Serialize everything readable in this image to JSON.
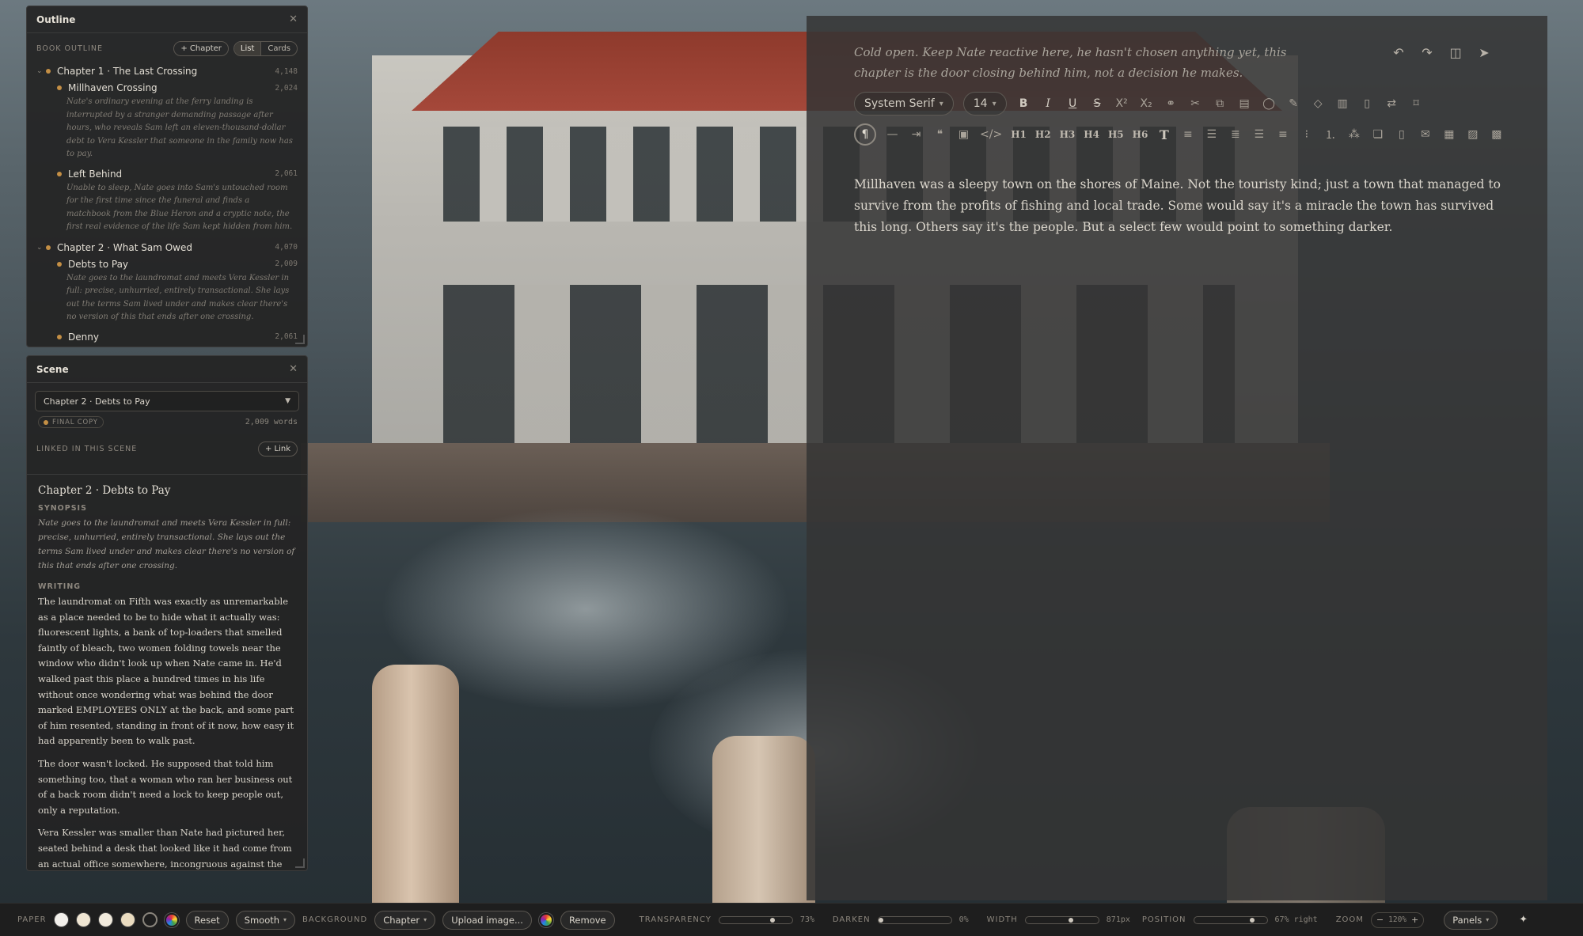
{
  "editor": {
    "note": "Cold open. Keep Nate reactive here, he hasn't chosen anything yet, this chapter is the door closing behind him, not a decision he makes.",
    "toolbar": {
      "font_family": "System Serif",
      "font_size": "14",
      "superscript": "X²",
      "subscript": "X₂",
      "headings": [
        "H1",
        "H2",
        "H3",
        "H4",
        "H5",
        "H6"
      ]
    },
    "prose": "Millhaven was a sleepy town on the shores of Maine. Not the touristy kind; just a town that managed to survive from the profits of fishing and local trade. Some would say it's a miracle the town has survived this long. Others say it's the people. But a select few would point to something darker."
  },
  "outline": {
    "title": "Outline",
    "section_label": "BOOK OUTLINE",
    "add_chapter": "+ Chapter",
    "view_list": "List",
    "view_cards": "Cards",
    "chapters": [
      {
        "name": "Chapter 1 · The Last Crossing",
        "count": "4,148",
        "scenes": [
          {
            "name": "Millhaven Crossing",
            "count": "2,024",
            "synopsis": "Nate's ordinary evening at the ferry landing is interrupted by a stranger demanding passage after hours, who reveals Sam left an eleven-thousand-dollar debt to Vera Kessler that someone in the family now has to pay."
          },
          {
            "name": "Left Behind",
            "count": "2,061",
            "synopsis": "Unable to sleep, Nate goes into Sam's untouched room for the first time since the funeral and finds a matchbook from the Blue Heron and a cryptic note, the first real evidence of the life Sam kept hidden from him."
          }
        ]
      },
      {
        "name": "Chapter 2 · What Sam Owed",
        "count": "4,070",
        "scenes": [
          {
            "name": "Debts to Pay",
            "count": "2,009",
            "synopsis": "Nate goes to the laundromat and meets Vera Kessler in full: precise, unhurried, entirely transactional. She lays out the terms Sam lived under and makes clear there's no version of this that ends after one crossing."
          },
          {
            "name": "Denny",
            "count": "2,061",
            "synopsis": ""
          }
        ]
      }
    ]
  },
  "scene": {
    "title": "Scene",
    "selected": "Chapter 2 · Debts to Pay",
    "status": "FINAL COPY",
    "words": "2,009 words",
    "linked_label": "LINKED IN THIS SCENE",
    "link_button": "+ Link",
    "heading": "Chapter 2 · Debts to Pay",
    "synopsis_label": "SYNOPSIS",
    "synopsis": "Nate goes to the laundromat and meets Vera Kessler in full: precise, unhurried, entirely transactional. She lays out the terms Sam lived under and makes clear there's no version of this that ends after one crossing.",
    "writing_label": "WRITING",
    "paragraphs": [
      "The laundromat on Fifth was exactly as unremarkable as a place needed to be to hide what it actually was: fluorescent lights, a bank of top-loaders that smelled faintly of bleach, two women folding towels near the window who didn't look up when Nate came in. He'd walked past this place a hundred times in his life without once wondering what was behind the door marked EMPLOYEES ONLY at the back, and some part of him resented, standing in front of it now, how easy it had apparently been to walk past.",
      "The door wasn't locked. He supposed that told him something too, that a woman who ran her business out of a back room didn't need a lock to keep people out, only a reputation.",
      "Vera Kessler was smaller than Nate had pictured her, seated behind a desk that looked like it had come from an actual office somewhere, incongruous against the cinderblock"
    ]
  },
  "bottom": {
    "paper_label": "PAPER",
    "paper_swatches": [
      "#f2f0eb",
      "#efe5d2",
      "#f1eadc",
      "#eadcc0",
      "transparent"
    ],
    "reset": "Reset",
    "smooth": "Smooth",
    "background_label": "BACKGROUND",
    "background_mode": "Chapter",
    "upload": "Upload image...",
    "remove": "Remove",
    "transparency_label": "TRANSPARENCY",
    "transparency_value": "73%",
    "transparency": 0.73,
    "darken_label": "DARKEN",
    "darken_value": "0%",
    "darken": 0,
    "width_label": "WIDTH",
    "width_value": "871px",
    "width_level": 0.62,
    "position_label": "POSITION",
    "position_value": "67% right",
    "position": 0.8,
    "zoom_label": "ZOOM",
    "zoom_value": "120%",
    "panels": "Panels"
  },
  "colors": {
    "accent": "#c48f45"
  }
}
